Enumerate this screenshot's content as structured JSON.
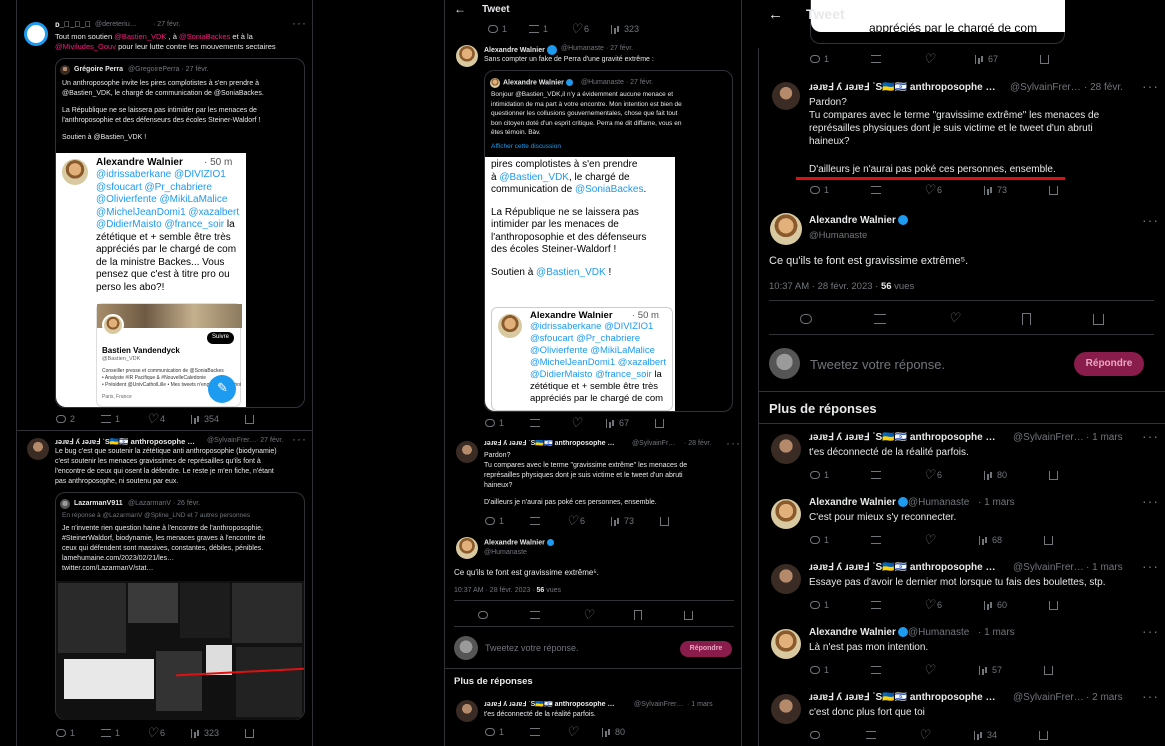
{
  "p1": {
    "t1": {
      "name": "ᴅ_ᷞ_ᷡ_ᷝ ",
      "handle": "@dereteriu…",
      "date": "· 27 févr.",
      "l1a": "Tout mon soutien ",
      "l1b": "@Bastien_VDK",
      "l1c": " , à ",
      "l1d": "@SoniaBackes",
      "l1e": " et à la",
      "l2a": "@Miviludes_Gouv",
      "l2b": " pour leur lutte contre les mouvements sectaires",
      "q": {
        "name": "Grégoire Perra",
        "handle": "@GregoirePerra · 27 févr.",
        "lines": [
          "Un anthroposophe invite les pires complotistes à s'en prendre à",
          "@Bastien_VDK, le chargé de communication de @SoniaBackes.",
          "",
          "La République ne se laissera pas intimider par les menaces de",
          "l'anthroposophie et des défenseurs des écoles Steiner-Waldorf !",
          "",
          "Soutien à @Bastien_VDK !"
        ]
      },
      "shot": {
        "name": "Alexandre Walnier",
        "time": "· 50 m",
        "lines": [
          "@idrissaberkane @DIVIZIO1",
          "@sfoucart @Pr_chabriere",
          "@Olivierfente @MikiLaMalice",
          "@MichelJeanDomi1 @xazalbert",
          "@DidierMaisto @france_soir la",
          "zététique et + semble être très",
          "appréciés par le chargé de com",
          "de la ministre Backes... Vous",
          "pensez que c'est à titre pro ou",
          "perso les abo?!"
        ],
        "profile": "Bastien Vandendyck",
        "phandle": "@Bastien_VDK",
        "follow": "Suivre",
        "bio1": "Conseiller presse et communication de @SoniaBackes",
        "bio2": "• Analyste #IR Pacifique & #NouvelleCaledonie",
        "bio3": "• Président @UnivCatholLille • Mes tweets n'engagent que moi",
        "loc": "Paris, France"
      },
      "stats": [
        "2",
        "1",
        "4",
        "354"
      ]
    },
    "t2": {
      "name": "ɹǝɹɐℲ ʎ ɹǝɹɐℲ ˙S🇺🇦🇮🇱 anthroposophe …",
      "handle": "@SylvainFrer…",
      "date": "· 27 févr.",
      "lines": [
        "Le bug c'est que soutenir la zététique anti anthroposophie (biodynamie)",
        "c'est soutenir les menaces gravissimes de représailles qu'ils font à",
        "l'encontre de ceux qui osent la défendre. Le reste je m'en fiche, n'étant",
        "pas anthroposophe, ni soutenu par eux."
      ],
      "q": {
        "name": "LazarmanV911",
        "handle": "@LazarmanV · 26 févr.",
        "reply": "En réponse à @LazarmanV @Spline_LND et 7 autres personnes",
        "lines": [
          "Je n'invente rien question haine à l'encontre de l'anthroposophie,",
          "#SteinerWaldorf, biodynamie, les menaces graves à l'encontre de",
          "ceux qui défendent sont massives, constantes, débiles, pénibles.",
          "lamehumaine.com/2023/02/21/les…",
          "twitter.com/LazarmanV/stat…"
        ]
      },
      "stats": [
        "1",
        "1",
        "6",
        "323"
      ]
    }
  },
  "p2": {
    "header": "Tweet",
    "topstats": [
      "1",
      "1",
      "6",
      "323"
    ],
    "t1": {
      "name": "Alexandre Walnier",
      "handle": "@Humanaste · 27 févr.",
      "line": "Sans compter un fake de Perra d'une gravité extrême :",
      "q": {
        "name": "Alexandre Walnier",
        "handle": "@Humanaste · 27 févr.",
        "lines": [
          "Bonjour @Bastien_VDK,il n'y a évidemment aucune menace et",
          "intimidation de ma part à votre encontre. Mon intention est bien de",
          "questionner les collusions gouvernementales, chose que fait tout",
          "bon citoyen doté d'un esprit critique. Perra me dit diffame, vous en",
          "êtes témoin. Bàv."
        ],
        "more": "Afficher cette discussion"
      },
      "shot": {
        "lines": [
          "pires complotistes à s'en prendre",
          "à @Bastien_VDK, le chargé de",
          "communication de @SoniaBackes.",
          "",
          "La République ne se laissera pas",
          "intimider par les menaces de",
          "l'anthroposophie et des défenseurs",
          "des écoles Steiner-Waldorf !",
          "",
          "Soutien à @Bastien_VDK !"
        ],
        "name": "Alexandre Walnier",
        "time": "· 50 m",
        "lines2": [
          "@idrissaberkane @DIVIZIO1",
          "@sfoucart @Pr_chabriere",
          "@Olivierfente @MikiLaMalice",
          "@MichelJeanDomi1 @xazalbert",
          "@DidierMaisto @france_soir la",
          "zététique et + semble être très",
          "appréciés par le chargé de com"
        ]
      },
      "stats": [
        "1",
        "",
        "67"
      ]
    },
    "t2": {
      "name": "ɹǝɹɐℲ ʎ ɹǝɹɐℲ ˙S🇺🇦🇮🇱 anthroposophe …",
      "handle": "@SylvainFr…",
      "date": "· 28 févr.",
      "lines": [
        "Pardon?",
        "Tu compares avec le terme \"gravissime extrême\" les menaces de",
        "représailles physiques dont je suis victime et le tweet d'un abruti",
        "haineux?",
        "",
        "D'ailleurs je n'aurai pas poké ces personnes, ensemble."
      ],
      "stats": [
        "1",
        "",
        "6",
        "73"
      ]
    },
    "main": {
      "name": "Alexandre Walnier",
      "handle": "@Humanaste",
      "text": "Ce qu'ils te font est gravissime extrême⁵.",
      "time": "10:37 AM · 28 févr. 2023 · ",
      "views": "56",
      "views_label": " vues"
    },
    "reply_ph": "Tweetez votre réponse.",
    "reply_btn": "Répondre",
    "more": "Plus de réponses",
    "t3": {
      "name": "ɹǝɹɐℲ ʎ ɹǝɹɐℲ ˙S🇺🇦🇮🇱 anthroposophe …",
      "handle": "@SylvainFrer…",
      "date": "· 1 mars",
      "text": "t'es déconnecté de la réalité parfois.",
      "stats": [
        "1",
        "",
        "",
        "80"
      ]
    }
  },
  "p3": {
    "header": "Tweet",
    "toptext": "appréciés par le chargé de com",
    "topstats": [
      "1",
      "",
      "",
      "67"
    ],
    "t1": {
      "name": "ɹǝɹɐℲ ʎ ɹǝɹɐℲ ˙S🇺🇦🇮🇱 anthroposophe …",
      "handle": "@SylvainFrer…",
      "date": "· 28 févr.",
      "lines": [
        "Pardon?",
        "Tu compares avec le terme \"gravissime extrême\" les menaces de",
        "représailles physiques dont je suis victime et le tweet d'un abruti",
        "haineux?"
      ],
      "last": "D'ailleurs je n'aurai pas poké ces personnes, ensemble.",
      "stats": [
        "1",
        "",
        "6",
        "73"
      ]
    },
    "main": {
      "name": "Alexandre Walnier",
      "handle": "@Humanaste",
      "text": "Ce qu'ils te font est gravissime extrême⁵.",
      "time": "10:37 AM · 28 févr. 2023 · ",
      "views": "56",
      "views_label": " vues"
    },
    "reply_ph": "Tweetez votre réponse.",
    "reply_btn": "Répondre",
    "more": "Plus de réponses",
    "replies": [
      {
        "name": "ɹǝɹɐℲ ʎ ɹǝɹɐℲ ˙S🇺🇦🇮🇱 anthroposophe …",
        "handle": "@SylvainFrer…",
        "date": "· 1 mars",
        "text": "t'es déconnecté de la réalité parfois.",
        "stats": [
          "1",
          "",
          "6",
          "80"
        ]
      },
      {
        "name": "Alexandre Walnier",
        "handle": "@Humanaste",
        "date": "· 1 mars",
        "text": "C'est pour mieux s'y reconnecter.",
        "stats": [
          "1",
          "",
          "",
          "68"
        ]
      },
      {
        "name": "ɹǝɹɐℲ ʎ ɹǝɹɐℲ ˙S🇺🇦🇮🇱 anthroposophe …",
        "handle": "@SylvainFrer…",
        "date": "· 1 mars",
        "text": "Essaye pas d'avoir le dernier mot lorsque tu fais des boulettes, stp.",
        "stats": [
          "1",
          "",
          "6",
          "60"
        ]
      },
      {
        "name": "Alexandre Walnier",
        "handle": "@Humanaste",
        "date": "· 1 mars",
        "text": "Là n'est pas mon intention.",
        "stats": [
          "1",
          "",
          "",
          "57"
        ]
      },
      {
        "name": "ɹǝɹɐℲ ʎ ɹǝɹɐℲ ˙S🇺🇦🇮🇱 anthroposophe …",
        "handle": "@SylvainFrer…",
        "date": "· 2 mars",
        "text": "c'est donc plus fort que toi",
        "stats": [
          "",
          "",
          "",
          "34"
        ]
      }
    ]
  }
}
